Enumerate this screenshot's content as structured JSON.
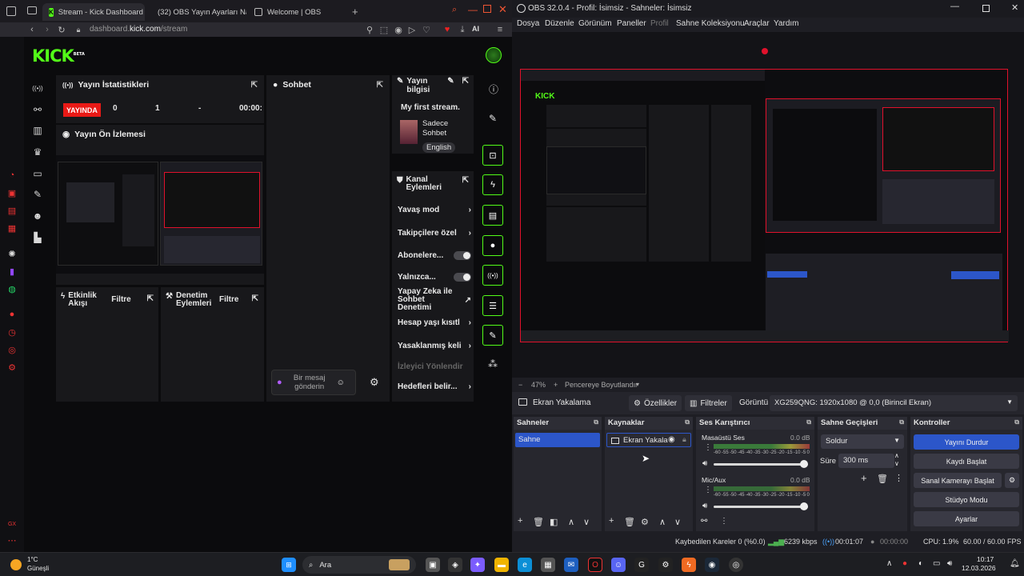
{
  "browser": {
    "tabs": [
      {
        "label": "Stream - Kick Dashboard",
        "active": true
      },
      {
        "label": "(32) OBS Yayın Ayarları Na",
        "active": false
      },
      {
        "label": "Welcome | OBS",
        "active": false
      }
    ],
    "url_host": "dashboard.",
    "url_domain": "kick.com",
    "url_path": "/stream",
    "ai_label": "AI"
  },
  "kick": {
    "logo": "KICK",
    "logo_badge": "BETA",
    "stats_title": "Yayın İstatistikleri",
    "live_badge": "YAYINDA",
    "stat_values": [
      "0",
      "1",
      "-",
      "00:00:"
    ],
    "preview_title": "Yayın Ön İzlemesi",
    "chat_title": "Sohbet",
    "chat_placeholder": "Bir mesaj gönderin",
    "stream_info_title": "Yayın bilgisi",
    "stream_title": "My first stream.",
    "category": "Sadece Sohbet",
    "language": "English",
    "channel_actions_title": "Kanal Eylemleri",
    "actions": [
      {
        "label": "Yavaş mod",
        "control": "chevron"
      },
      {
        "label": "Takipçilere özel",
        "control": "chevron"
      },
      {
        "label": "Abonelere...",
        "control": "toggle"
      },
      {
        "label": "Yalnızca...",
        "control": "toggle"
      },
      {
        "label": "Yapay Zeka ile Sohbet Denetimi",
        "control": "external"
      },
      {
        "label": "Hesap yaşı kısıtl",
        "control": "chevron"
      },
      {
        "label": "Yasaklanmış keli",
        "control": "chevron"
      },
      {
        "label": "İzleyici Yönlendir",
        "control": "none"
      },
      {
        "label": "Hedefleri belir...",
        "control": "chevron"
      }
    ],
    "activity_title": "Etkinlik Akışı",
    "activity_filter": "Filtre",
    "moderation_title": "Denetim Eylemleri",
    "moderation_filter": "Filtre",
    "accent": "#53fc18",
    "live_color": "#e91916"
  },
  "obs": {
    "title": "OBS 32.0.4 - Profil: İsimsiz - Sahneler: İsimsiz",
    "menu": [
      "Dosya",
      "Düzenle",
      "Görünüm",
      "Paneller",
      "Profil",
      "Sahne Koleksiyonu",
      "Araçlar",
      "Yardım"
    ],
    "zoom": "47%",
    "fit_label": "Pencereye Boyutlandır",
    "source_bar": {
      "source": "Ekran Yakalama",
      "properties": "Özellikler",
      "filters": "Filtreler",
      "display_label": "Görüntü",
      "display_value": "XG259QNG: 1920x1080 @ 0,0 (Birincil Ekran)"
    },
    "scenes_title": "Sahneler",
    "scenes": [
      "Sahne"
    ],
    "sources_title": "Kaynaklar",
    "sources": [
      "Ekran Yakala"
    ],
    "mixer_title": "Ses Karıştırıcı",
    "mixer": [
      {
        "name": "Masaüstü Ses",
        "db": "0.0 dB"
      },
      {
        "name": "Mic/Aux",
        "db": "0.0 dB"
      }
    ],
    "meter_ticks": [
      "-60",
      "-55",
      "-50",
      "-45",
      "-40",
      "-35",
      "-30",
      "-25",
      "-20",
      "-15",
      "-10",
      "-5",
      "0"
    ],
    "transitions_title": "Sahne Geçişleri",
    "transition": "Soldur",
    "duration_label": "Süre",
    "duration_value": "300 ms",
    "controls_title": "Kontroller",
    "controls": [
      "Yayını Durdur",
      "Kaydı Başlat",
      "Sanal Kamerayı Başlat",
      "Stüdyo Modu",
      "Ayarlar"
    ],
    "status": {
      "dropped": "Kaybedilen Kareler 0 (%0.0)",
      "bitrate": "6239 kbps",
      "stream_time": "00:01:07",
      "rec_time": "00:00:00",
      "cpu": "CPU: 1.9%",
      "fps": "60.00 / 60.00 FPS"
    },
    "accent": "#2c56c9",
    "outline_red": "#e0112b"
  },
  "taskbar": {
    "weather_temp": "1°C",
    "weather_desc": "Güneşli",
    "search": "Ara",
    "time": "10:17",
    "date": "12.03.2026"
  }
}
